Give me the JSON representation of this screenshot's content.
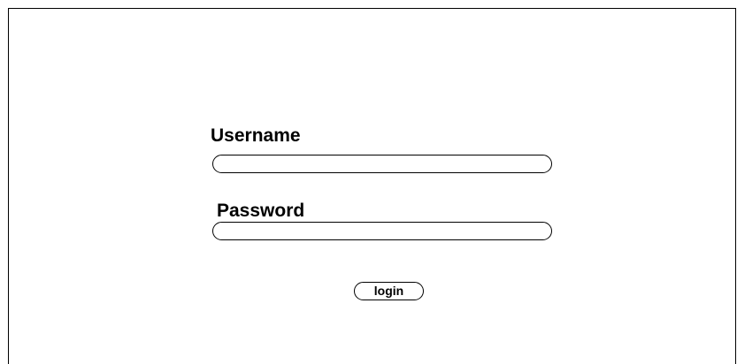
{
  "form": {
    "username_label": "Username",
    "username_value": "",
    "password_label": "Password",
    "password_value": "",
    "login_label": "login"
  }
}
